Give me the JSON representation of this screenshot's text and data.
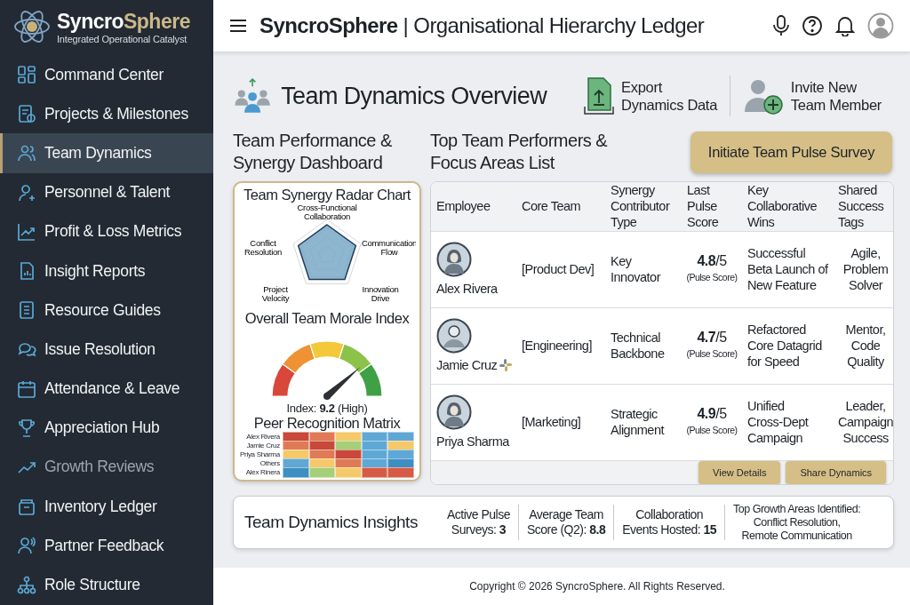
{
  "brand": {
    "name_part1": "Syncro",
    "name_part2": "Sphere",
    "tagline": "Integrated Operational Catalyst"
  },
  "sidebar": {
    "items": [
      {
        "label": "Command Center",
        "selected": false,
        "disabled": false
      },
      {
        "label": "Projects & Milestones",
        "selected": false,
        "disabled": false
      },
      {
        "label": "Team Dynamics",
        "selected": true,
        "disabled": false
      },
      {
        "label": "Personnel & Talent",
        "selected": false,
        "disabled": false
      },
      {
        "label": "Profit & Loss Metrics",
        "selected": false,
        "disabled": false
      },
      {
        "label": "Insight Reports",
        "selected": false,
        "disabled": false
      },
      {
        "label": "Resource Guides",
        "selected": false,
        "disabled": false
      },
      {
        "label": "Issue Resolution",
        "selected": false,
        "disabled": false
      },
      {
        "label": "Attendance & Leave",
        "selected": false,
        "disabled": false
      },
      {
        "label": "Appreciation Hub",
        "selected": false,
        "disabled": false
      },
      {
        "label": "Growth Reviews",
        "selected": false,
        "disabled": true
      },
      {
        "label": "Inventory Ledger",
        "selected": false,
        "disabled": false
      },
      {
        "label": "Partner Feedback",
        "selected": false,
        "disabled": false
      },
      {
        "label": "Role Structure",
        "selected": false,
        "disabled": false
      }
    ]
  },
  "topbar": {
    "app_name": "SyncroSphere",
    "separator": "|",
    "page_title": "Organisational Hierarchy Ledger"
  },
  "overview": {
    "title": "Team Dynamics Overview",
    "actions": [
      "Export\nDynamics Data",
      "Invite New\nTeam Member"
    ]
  },
  "dashboard": {
    "heading": "Team Performance &\nSynergy Dashboard",
    "radar": {
      "title": "Team Synergy Radar Chart",
      "axes": [
        "Cross-Functional\nCollaboration",
        "Conflict\nResolution",
        "Communication\nFlow",
        "Project\nVelocity",
        "Innovation\nDrive"
      ]
    },
    "morale": {
      "title": "Overall Team Morale Index",
      "reading": "Index: **9.2** (High)"
    },
    "matrix": {
      "title": "Peer Recognition Matrix",
      "rows": [
        {
          "label": "Alex Rivera",
          "cells": [
            {
              "color": "#c8483a"
            },
            {
              "color": "#df7a55"
            },
            {
              "color": "#f5c96a"
            },
            {
              "color": "#5fa8d6"
            },
            {
              "color": "#5fa8d6"
            }
          ]
        },
        {
          "label": "Jamie Cruz",
          "cells": [
            {
              "color": "#df7a55"
            },
            {
              "color": "#c8483a"
            },
            {
              "color": "#a5cf78"
            },
            {
              "color": "#5fa8d6"
            },
            {
              "color": "#f5c96a"
            }
          ]
        },
        {
          "label": "Priya Sharma",
          "cells": [
            {
              "color": "#f5c96a"
            },
            {
              "color": "#df7a55"
            },
            {
              "color": "#c8483a"
            },
            {
              "color": "#5fa8d6"
            },
            {
              "color": "#5fa8d6"
            }
          ]
        },
        {
          "label": "Others",
          "cells": [
            {
              "color": "#5fa8d6"
            },
            {
              "color": "#f5c96a"
            },
            {
              "color": "#df7a55"
            },
            {
              "color": "#5fa8d6"
            },
            {
              "color": "#3d8fc2"
            }
          ]
        },
        {
          "label": "Alex Rinera",
          "cells": [
            {
              "color": "#3d8fc2"
            },
            {
              "color": "#a5cf78"
            },
            {
              "color": "#f5c96a"
            },
            {
              "color": "#d65a45"
            },
            {
              "color": "#d65a45"
            }
          ]
        }
      ]
    }
  },
  "performers": {
    "heading": "Top Team Performers &\nFocus Areas List",
    "survey_button": "Initiate Team Pulse Survey",
    "columns": [
      "Employee",
      "Core Team",
      "Synergy\nContributor\nType",
      "Last\nPulse\nScore",
      "Key\nCollaborative\nWins",
      "Shared\nSuccess\nTags"
    ],
    "rows": [
      {
        "name": "Alex Rivera",
        "kind": "hooded",
        "badge": false,
        "team": "[Product Dev]",
        "type": "Key\nInnovator",
        "score": "**4.8**/5",
        "score_note": "(Pulse Score)",
        "wins": "Successful\nBeta Launch of\nNew Feature",
        "tags": "Agile,\nProblem\nSolver"
      },
      {
        "name": "Jamie Cruz",
        "kind": "person",
        "badge": true,
        "team": "[Engineering]",
        "type": "Technical\nBackbone",
        "score": "**4.7**/5",
        "score_note": "(Pulse Score)",
        "wins": "Refactored\nCore Datagrid\nfor Speed",
        "tags": "Mentor,\nCode\nQuality"
      },
      {
        "name": "Priya Sharma",
        "kind": "hooded",
        "badge": false,
        "team": "[Marketing]",
        "type": "Strategic\nAlignment",
        "score": "**4.9**/5",
        "score_note": "(Pulse Score)",
        "wins": "Unified\nCross-Dept\nCampaign",
        "tags": "Leader,\nCampaign\nSuccess"
      }
    ],
    "buttons": [
      "View Details",
      "Share Dynamics"
    ]
  },
  "insights": {
    "title": "Team Dynamics Insights",
    "stats": [
      "Active Pulse\nSurveys: **3**",
      "Average Team\nScore (Q2): **8.8**",
      "Collaboration\nEvents Hosted: **15**",
      "Top Growth Areas Identified:\nConflict Resolution,\nRemote Communication"
    ]
  },
  "footer": "Copyright © 2026 SyncroSphere. All Rights Reserved."
}
